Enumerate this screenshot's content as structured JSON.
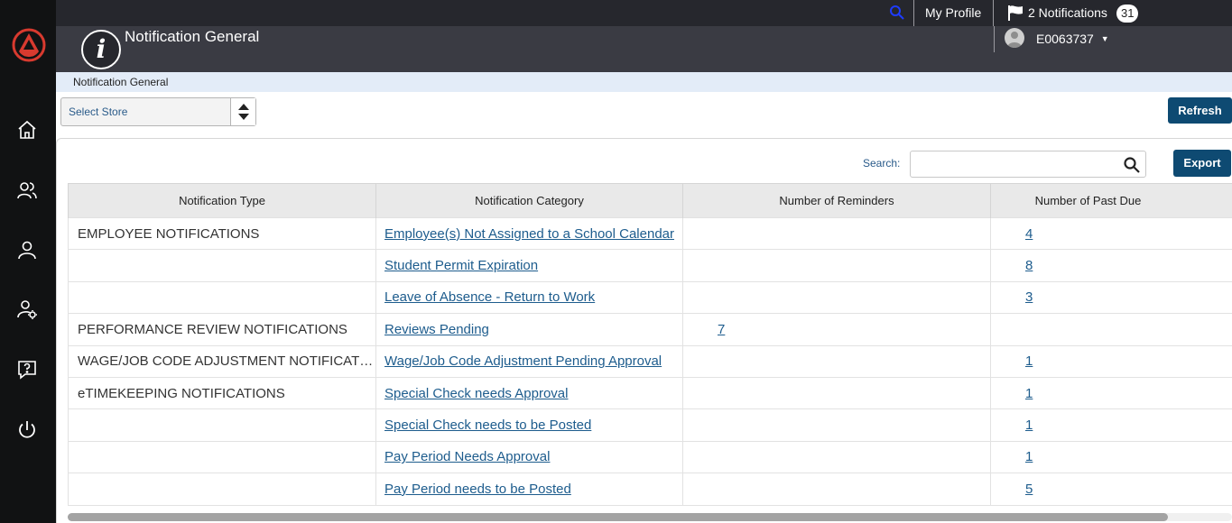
{
  "topbar": {
    "my_profile": "My Profile",
    "notifications_label": "2 Notifications",
    "notifications_badge": "31"
  },
  "header": {
    "title": "Notification General",
    "user": "E0063737"
  },
  "breadcrumb": "Notification General",
  "store_select": {
    "value": "Select Store"
  },
  "buttons": {
    "refresh": "Refresh",
    "export": "Export"
  },
  "search": {
    "label": "Search:",
    "value": ""
  },
  "table": {
    "headers": [
      "Notification Type",
      "Notification Category",
      "Number of Reminders",
      "Number of Past Due"
    ],
    "rows": [
      {
        "type": "EMPLOYEE NOTIFICATIONS",
        "category": "Employee(s) Not Assigned to a School Calendar",
        "reminders": "",
        "past_due": "4"
      },
      {
        "type": "",
        "category": "Student Permit Expiration",
        "reminders": "",
        "past_due": "8"
      },
      {
        "type": "",
        "category": "Leave of Absence - Return to Work",
        "reminders": "",
        "past_due": "3"
      },
      {
        "type": "PERFORMANCE REVIEW NOTIFICATIONS",
        "category": "Reviews Pending",
        "reminders": "7",
        "past_due": ""
      },
      {
        "type": "WAGE/JOB CODE ADJUSTMENT NOTIFICATIONS",
        "category": "Wage/Job Code Adjustment Pending Approval",
        "reminders": "",
        "past_due": "1"
      },
      {
        "type": "eTIMEKEEPING NOTIFICATIONS",
        "category": "Special Check needs Approval",
        "reminders": "",
        "past_due": "1"
      },
      {
        "type": "",
        "category": "Special Check needs to be Posted",
        "reminders": "",
        "past_due": "1"
      },
      {
        "type": "",
        "category": "Pay Period Needs Approval",
        "reminders": "",
        "past_due": "1"
      },
      {
        "type": "",
        "category": "Pay Period needs to be Posted",
        "reminders": "",
        "past_due": "5"
      }
    ]
  },
  "icons": {
    "sidebar": [
      "home-icon",
      "users-icon",
      "user-icon",
      "user-settings-icon",
      "help-icon",
      "power-icon"
    ],
    "brand": "logo-icon"
  },
  "colors": {
    "accent": "#0e4a72",
    "link": "#1d5c8d",
    "logo": "#d83a2f"
  }
}
